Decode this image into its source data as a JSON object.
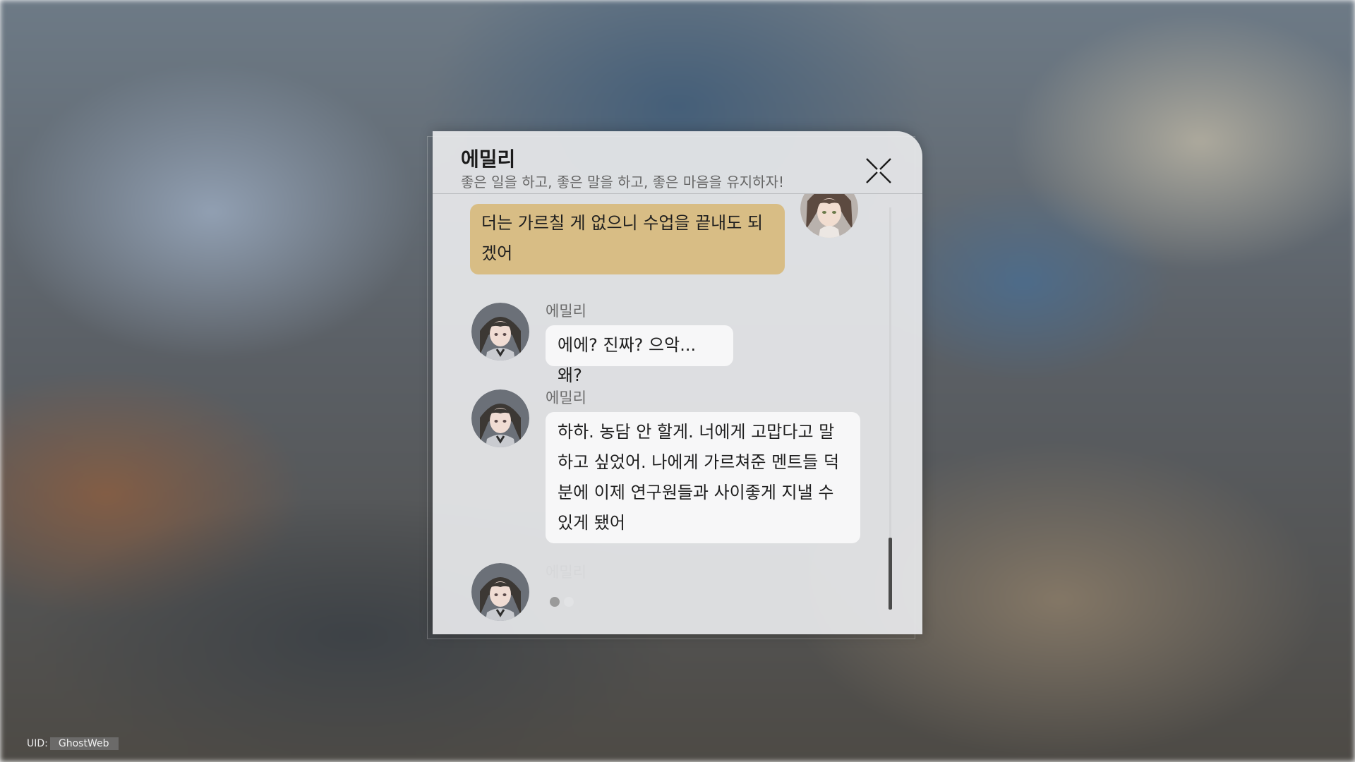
{
  "header": {
    "title": "에밀리",
    "subtitle": "좋은 일을 하고, 좋은 말을 하고, 좋은 마음을 유지하자!"
  },
  "messages": [
    {
      "sender": "player",
      "text": "더는 가르칠 게 없으니 수업을 끝내도 되겠어"
    },
    {
      "sender": "npc",
      "name": "에밀리",
      "text": "에에? 진짜? 으악... 왜?"
    },
    {
      "sender": "npc",
      "name": "에밀리",
      "text": "하하. 농담 안 할게. 너에게 고맙다고 말하고 싶었어. 나에게 가르쳐준 멘트들 덕분에 이제 연구원들과 사이좋게 지낼 수 있게 됐어"
    },
    {
      "sender": "npc",
      "name": "에밀리",
      "typing": true
    }
  ],
  "footer": {
    "uid_label": "UID:",
    "uid_value": "GhostWeb"
  },
  "colors": {
    "player_bubble": "#d8bd85",
    "npc_bubble": "#f7f7f8",
    "panel_bg": "#e8e9eb"
  },
  "icons": {
    "close": "close-x-icon",
    "typing": "typing-indicator-icon"
  }
}
